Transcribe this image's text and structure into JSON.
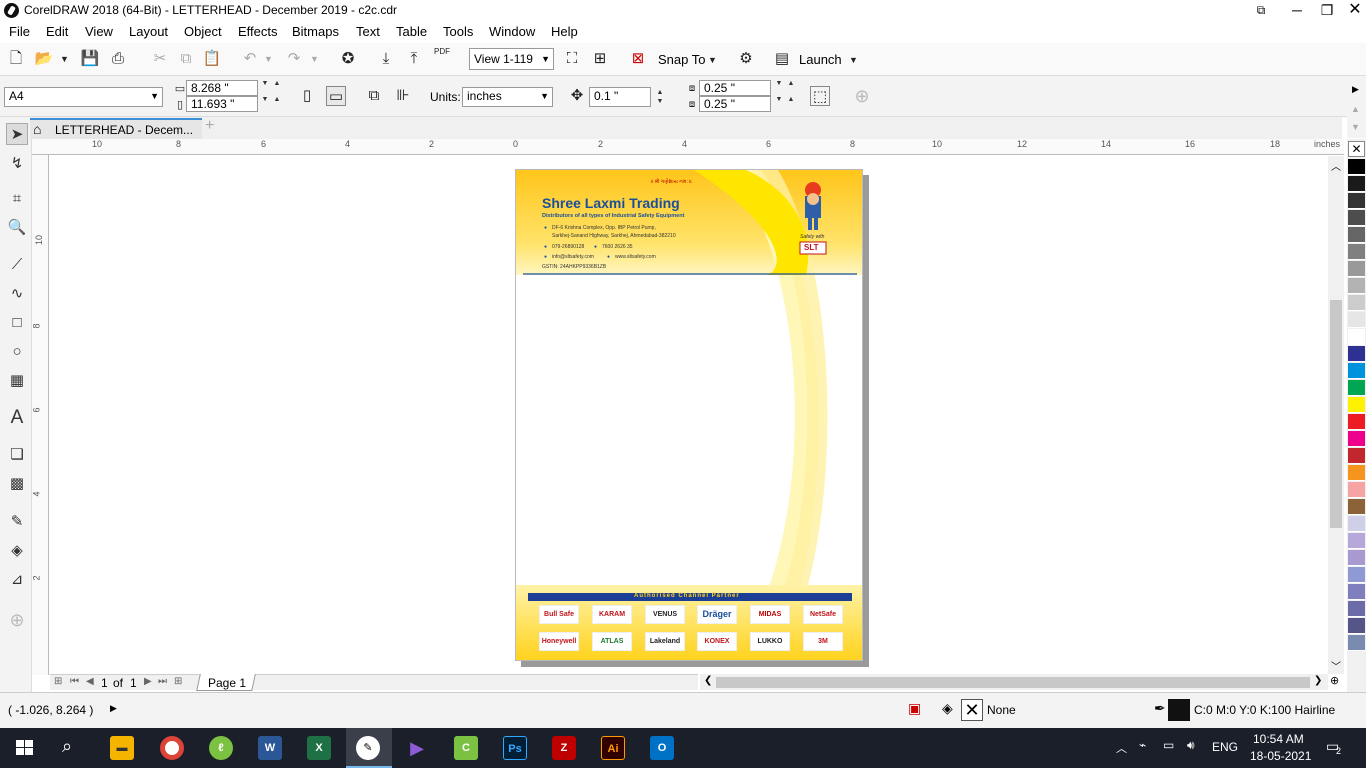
{
  "window": {
    "title": "CorelDRAW 2018 (64-Bit) - LETTERHEAD - December 2019 - c2c.cdr"
  },
  "menu": [
    "File",
    "Edit",
    "View",
    "Layout",
    "Object",
    "Effects",
    "Bitmaps",
    "Text",
    "Table",
    "Tools",
    "Window",
    "Help"
  ],
  "standard_toolbar": {
    "view_value": "View 1-119",
    "snap_to_label": "Snap To",
    "launch_label": "Launch",
    "pdf_label": "PDF"
  },
  "property_bar": {
    "paper_size": "A4",
    "width": "8.268 \"",
    "height": "11.693 \"",
    "units_label": "Units:",
    "units_value": "inches",
    "nudge": "0.1 \"",
    "dup_x": "0.25 \"",
    "dup_y": "0.25 \""
  },
  "document_tab": {
    "label": "LETTERHEAD - Decem..."
  },
  "ruler": {
    "unit": "inches",
    "h_ticks": [
      "10",
      "8",
      "6",
      "4",
      "2",
      "0",
      "2",
      "4",
      "6",
      "8",
      "10",
      "12",
      "14",
      "16",
      "18"
    ],
    "v_ticks": [
      "10",
      "8",
      "6",
      "4",
      "2"
    ]
  },
  "letterhead": {
    "sanskrit": "॥ श्री ગણેશાય નમઃ ॥",
    "company": "Shree Laxmi Trading",
    "tagline": "Distributors of all types of Industrial Safety Equipment",
    "address1": "DF-6 Krishna Complex, Opp. IBP Petrol Pump,",
    "address2": "Sarkhej-Sanand Highway, Sarkhej, Ahmedabad-382210",
    "phone1": "079-26890128",
    "phone2": "7600 2626 35",
    "email": "info@sltsafety.com",
    "web": "www.sltsafety.com",
    "gstin": "GSTIN: 24AHKPP9336B1ZB",
    "mascot_caption": "Safety with",
    "mascot_logo": "SLT",
    "partner_heading": "Authorised Channel Partner",
    "partners_row1": [
      "Bull Safe",
      "KARAM",
      "VENUS",
      "Dräger",
      "MIDAS",
      "NetSafe"
    ],
    "partners_row2": [
      "Honeywell",
      "ATLAS",
      "Lakeland",
      "KONEX",
      "LUKKO",
      "3M"
    ]
  },
  "page_nav": {
    "current": "1",
    "of_label": "of",
    "total": "1",
    "page_tab": "Page 1"
  },
  "status_bar": {
    "coords": "( -1.026, 8.264 )",
    "fill_label": "None",
    "outline_label": "C:0 M:0 Y:0 K:100  Hairline"
  },
  "taskbar": {
    "language": "ENG",
    "time": "10:54 AM",
    "date": "18-05-2021",
    "notifications": "2"
  },
  "colors": {
    "accent": "#3c8fd6",
    "letterhead_yellow": "#ffd21a",
    "letterhead_blue": "#1a4f9c",
    "partner_bar": "#1c3f95"
  },
  "palette": [
    "#000000",
    "#1a1a1a",
    "#333333",
    "#4d4d4d",
    "#666666",
    "#808080",
    "#999999",
    "#b3b3b3",
    "#cccccc",
    "#e6e6e6",
    "#ffffff",
    "#2e3192",
    "#0093dd",
    "#00a651",
    "#fff200",
    "#ed1c24",
    "#ec008c",
    "#c1272d",
    "#f7941d",
    "#f5a3a3",
    "#8c6239",
    "#cfcfe8",
    "#b6a9d9",
    "#a89ad1",
    "#8f9ad4",
    "#7f7fbf",
    "#6b6ba8",
    "#555587",
    "#7a8bb0"
  ]
}
